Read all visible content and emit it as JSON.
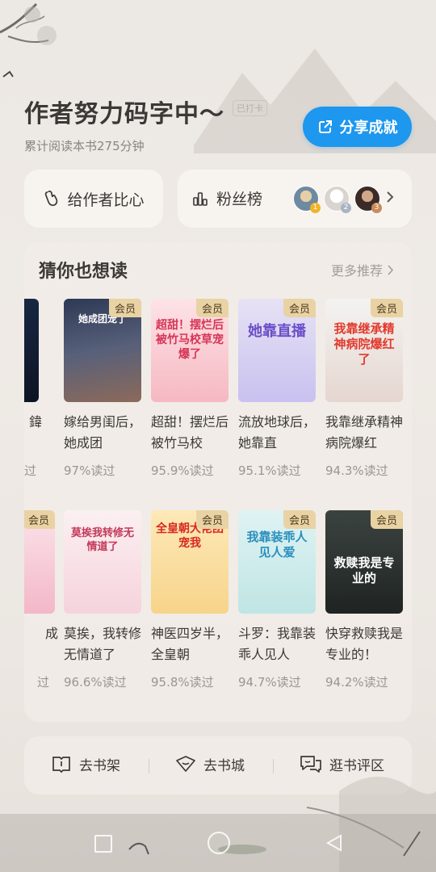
{
  "header": {
    "title": "作者努力码字中～",
    "stamp": "已打卡",
    "subtitle": "累计阅读本书275分钟"
  },
  "share_button": {
    "label": "分享成就",
    "color": "#1e97ee"
  },
  "heart_card": {
    "label": "给作者比心"
  },
  "fans_card": {
    "label": "粉丝榜",
    "ranks": [
      "1",
      "2",
      "3"
    ]
  },
  "recommend": {
    "title": "猜你也想读",
    "more": "更多推荐",
    "vip_label": "会员",
    "row1": [
      {
        "title": "嫁给男闺后，她成团",
        "read": "97%读过",
        "cover": "她成团宠了"
      },
      {
        "title": "超甜！摆烂后被竹马校",
        "read": "95.9%读过",
        "cover": "超甜！摆烂后被竹马校草宠爆了"
      },
      {
        "title": "流放地球后，她靠直",
        "read": "95.1%读过",
        "cover": "她靠直播"
      },
      {
        "title": "我靠继承精神病院爆红",
        "read": "94.3%读过",
        "cover": "我靠继承精神病院爆红了"
      }
    ],
    "row2": [
      {
        "title": "莫挨，我转修无情道了",
        "read": "96.6%读过",
        "cover": "莫挨我转修无情道了"
      },
      {
        "title": "神医四岁半，全皇朝",
        "read": "95.8%读过",
        "cover": "全皇朝大佬团宠我"
      },
      {
        "title": "斗罗：我靠装乖人见人",
        "read": "94.7%读过",
        "cover": "我靠装乖人见人爱"
      },
      {
        "title": "快穿救赎我是专业的！",
        "read": "94.2%读过",
        "cover": "救赎我是专业的"
      }
    ],
    "partial_row1": {
      "title": "鍏",
      "read": "过"
    },
    "partial_row2": {
      "title": "成",
      "read": "过"
    }
  },
  "bottom_nav": {
    "bookshelf": "去书架",
    "bookstore": "去书城",
    "reviews": "逛书评区"
  }
}
